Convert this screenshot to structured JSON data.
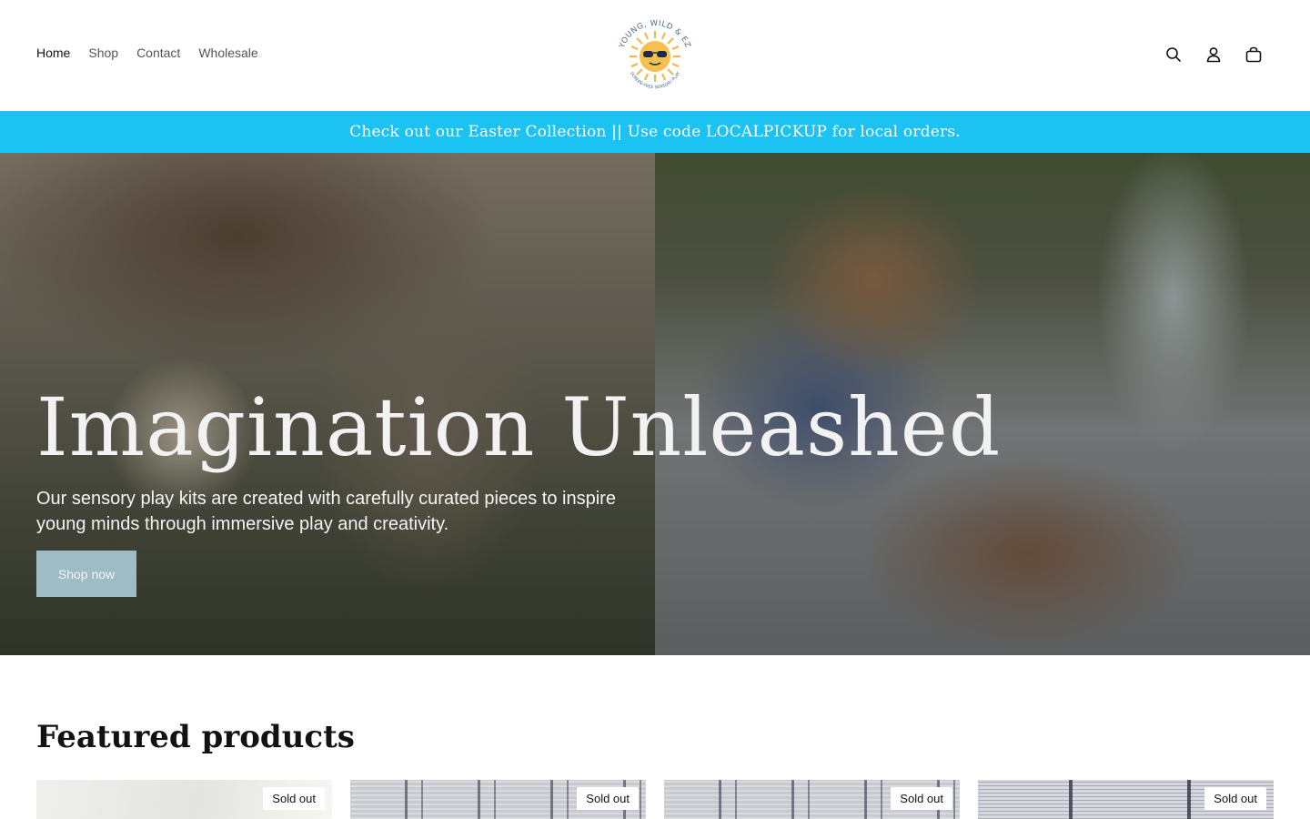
{
  "header": {
    "nav": [
      {
        "label": "Home",
        "active": true
      },
      {
        "label": "Shop",
        "active": false
      },
      {
        "label": "Contact",
        "active": false
      },
      {
        "label": "Wholesale",
        "active": false
      }
    ],
    "logo": {
      "text_top": "YOUNG, WILD & EZ",
      "text_bottom": "SCREEN-FREE SENSORY PLAY"
    },
    "icons": [
      "search-icon",
      "account-icon",
      "cart-icon"
    ]
  },
  "announcement": {
    "text": "Check out our Easter Collection || Use code LOCALPICKUP for local orders.",
    "bg_color": "#1bc2f2"
  },
  "hero": {
    "title": "Imagination Unleashed",
    "subtitle": "Our sensory play kits are created with carefully curated pieces to inspire young minds through immersive play and creativity.",
    "button_label": "Shop now",
    "button_color": "#9ebcc4"
  },
  "featured": {
    "title": "Featured products",
    "products": [
      {
        "badge": "Sold out"
      },
      {
        "badge": "Sold out"
      },
      {
        "badge": "Sold out"
      },
      {
        "badge": "Sold out"
      }
    ]
  }
}
